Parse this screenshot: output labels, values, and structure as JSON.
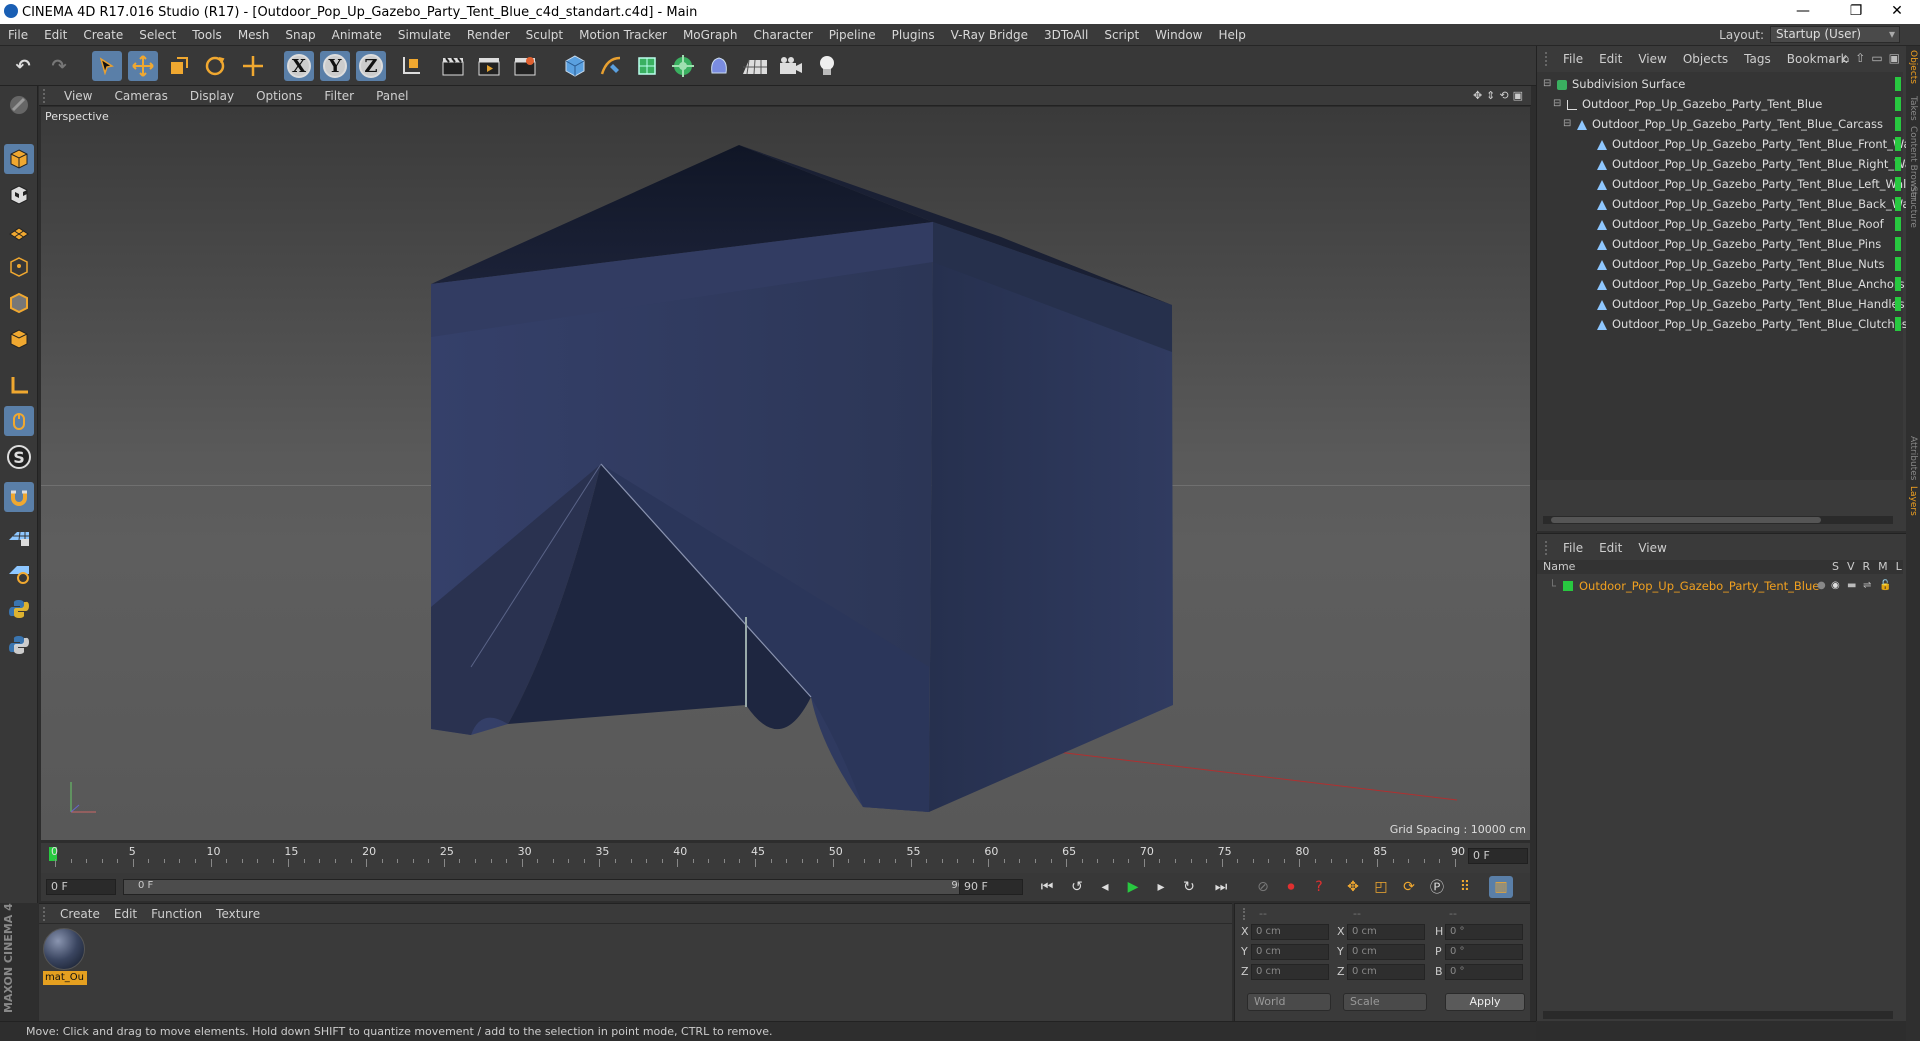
{
  "window": {
    "title": "CINEMA 4D R17.016 Studio (R17) - [Outdoor_Pop_Up_Gazebo_Party_Tent_Blue_c4d_standart.c4d] - Main"
  },
  "menubar": {
    "items": [
      "File",
      "Edit",
      "Create",
      "Select",
      "Tools",
      "Mesh",
      "Snap",
      "Animate",
      "Simulate",
      "Render",
      "Sculpt",
      "Motion Tracker",
      "MoGraph",
      "Character",
      "Pipeline",
      "Plugins",
      "V-Ray Bridge",
      "3DToAll",
      "Script",
      "Window",
      "Help"
    ],
    "layout_label": "Layout:",
    "layout_value": "Startup (User)"
  },
  "viewport": {
    "menu": [
      "View",
      "Cameras",
      "Display",
      "Options",
      "Filter",
      "Panel"
    ],
    "camera_label": "Perspective",
    "grid_spacing": "Grid Spacing : 10000 cm"
  },
  "timeline": {
    "ticks": [
      "0",
      "5",
      "10",
      "15",
      "20",
      "25",
      "30",
      "35",
      "40",
      "45",
      "50",
      "55",
      "60",
      "65",
      "70",
      "75",
      "80",
      "85",
      "90"
    ],
    "current_frame_display": "0 F",
    "start_field": "0 F",
    "range_start": "0 F",
    "range_end": "90 F",
    "end_field": "90 F"
  },
  "material_manager": {
    "menu": [
      "Create",
      "Edit",
      "Function",
      "Texture"
    ],
    "materials": [
      {
        "name": "mat_Ou"
      }
    ]
  },
  "coordinates": {
    "rows": [
      {
        "axis": "X",
        "pos": "0 cm",
        "axis2": "X",
        "size": "0 cm",
        "rot_label": "H",
        "rot": "0 °"
      },
      {
        "axis": "Y",
        "pos": "0 cm",
        "axis2": "Y",
        "size": "0 cm",
        "rot_label": "P",
        "rot": "0 °"
      },
      {
        "axis": "Z",
        "pos": "0 cm",
        "axis2": "Z",
        "size": "0 cm",
        "rot_label": "B",
        "rot": "0 °"
      }
    ],
    "mode_world": "World",
    "mode_scale": "Scale",
    "apply_label": "Apply",
    "header_dashes": "--"
  },
  "object_manager": {
    "menu": [
      "File",
      "Edit",
      "View",
      "Objects",
      "Tags",
      "Bookmark"
    ],
    "objects": [
      {
        "name": "Subdivision Surface",
        "level": 0
      },
      {
        "name": "Outdoor_Pop_Up_Gazebo_Party_Tent_Blue",
        "level": 1
      },
      {
        "name": "Outdoor_Pop_Up_Gazebo_Party_Tent_Blue_Carcass",
        "level": 2
      },
      {
        "name": "Outdoor_Pop_Up_Gazebo_Party_Tent_Blue_Front_Wall",
        "level": 3
      },
      {
        "name": "Outdoor_Pop_Up_Gazebo_Party_Tent_Blue_Right_Wall",
        "level": 3
      },
      {
        "name": "Outdoor_Pop_Up_Gazebo_Party_Tent_Blue_Left_Wall",
        "level": 3
      },
      {
        "name": "Outdoor_Pop_Up_Gazebo_Party_Tent_Blue_Back_Wall",
        "level": 3
      },
      {
        "name": "Outdoor_Pop_Up_Gazebo_Party_Tent_Blue_Roof",
        "level": 3
      },
      {
        "name": "Outdoor_Pop_Up_Gazebo_Party_Tent_Blue_Pins",
        "level": 3
      },
      {
        "name": "Outdoor_Pop_Up_Gazebo_Party_Tent_Blue_Nuts",
        "level": 3
      },
      {
        "name": "Outdoor_Pop_Up_Gazebo_Party_Tent_Blue_Anchors",
        "level": 3
      },
      {
        "name": "Outdoor_Pop_Up_Gazebo_Party_Tent_Blue_Handles",
        "level": 3
      },
      {
        "name": "Outdoor_Pop_Up_Gazebo_Party_Tent_Blue_Clutches",
        "level": 3
      }
    ]
  },
  "layer_manager": {
    "menu": [
      "File",
      "Edit",
      "View"
    ],
    "columns": {
      "name": "Name",
      "flags": [
        "S",
        "V",
        "R",
        "M",
        "L"
      ]
    },
    "layers": [
      {
        "name": "Outdoor_Pop_Up_Gazebo_Party_Tent_Blue",
        "color": "#28c840"
      }
    ]
  },
  "right_tabs": [
    "Objects",
    "Takes",
    "Content Browser",
    "Structure",
    "Attributes",
    "Layers"
  ],
  "status": {
    "text": "Move: Click and drag to move elements. Hold down SHIFT to quantize movement / add to the selection in point mode, CTRL to remove."
  },
  "branding": {
    "maxon": "MAXON CINEMA 4D"
  },
  "colors": {
    "accent": "#5a7fa8",
    "tent_fabric": "#2c3654",
    "layer_orange": "#f0a020",
    "green_tag": "#28c840"
  }
}
